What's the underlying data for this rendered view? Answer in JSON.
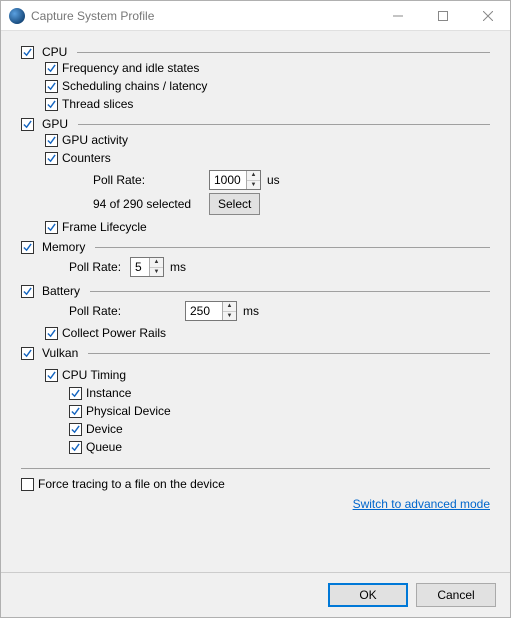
{
  "window": {
    "title": "Capture System Profile"
  },
  "cpu": {
    "label": "CPU",
    "freq": "Frequency and idle states",
    "sched": "Scheduling chains / latency",
    "threads": "Thread slices"
  },
  "gpu": {
    "label": "GPU",
    "activity": "GPU activity",
    "counters": "Counters",
    "poll_label": "Poll Rate:",
    "poll_value": "1000",
    "poll_unit": "us",
    "selected_text": "94 of 290 selected",
    "select_btn": "Select",
    "frame_lifecycle": "Frame Lifecycle"
  },
  "memory": {
    "label": "Memory",
    "poll_label": "Poll Rate:",
    "poll_value": "5",
    "poll_unit": "ms"
  },
  "battery": {
    "label": "Battery",
    "poll_label": "Poll Rate:",
    "poll_value": "250",
    "poll_unit": "ms",
    "power_rails": "Collect Power Rails"
  },
  "vulkan": {
    "label": "Vulkan",
    "cpu_timing": "CPU Timing",
    "instance": "Instance",
    "physical_device": "Physical Device",
    "device": "Device",
    "queue": "Queue"
  },
  "force_trace": "Force tracing to a file on the device",
  "advanced_link": "Switch to advanced mode",
  "buttons": {
    "ok": "OK",
    "cancel": "Cancel"
  }
}
